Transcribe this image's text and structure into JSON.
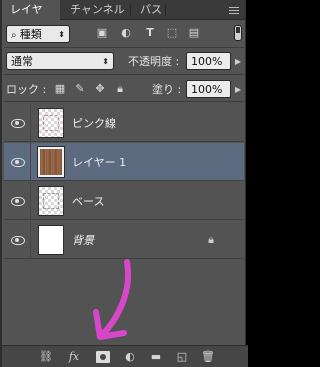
{
  "tabs": [
    "レイヤー",
    "チャンネル",
    "パス"
  ],
  "filter": {
    "kind_label": "種類",
    "search_icon": "search-icon"
  },
  "blend": {
    "mode": "通常",
    "opacity_label": "不透明度 :",
    "opacity_value": "100%"
  },
  "lock": {
    "label": "ロック :",
    "fill_label": "塗り :",
    "fill_value": "100%"
  },
  "layers": [
    {
      "name": "ピンク線",
      "thumb": "checker-pink",
      "selected": false
    },
    {
      "name": "レイヤー 1",
      "thumb": "wood",
      "selected": true
    },
    {
      "name": "ベース",
      "thumb": "checker-dots",
      "selected": false
    },
    {
      "name": "背景",
      "thumb": "white",
      "selected": false,
      "locked": true
    }
  ],
  "bottom_icons": [
    "link-icon",
    "fx-icon",
    "layer-mask-icon",
    "adjustment-icon",
    "folder-icon",
    "new-layer-icon",
    "trash-icon"
  ],
  "bottom_fx_label": "fx",
  "colors": {
    "panel": "#535353",
    "selected_layer": "#5d6b80",
    "annotation_arrow": "#d648c9"
  }
}
